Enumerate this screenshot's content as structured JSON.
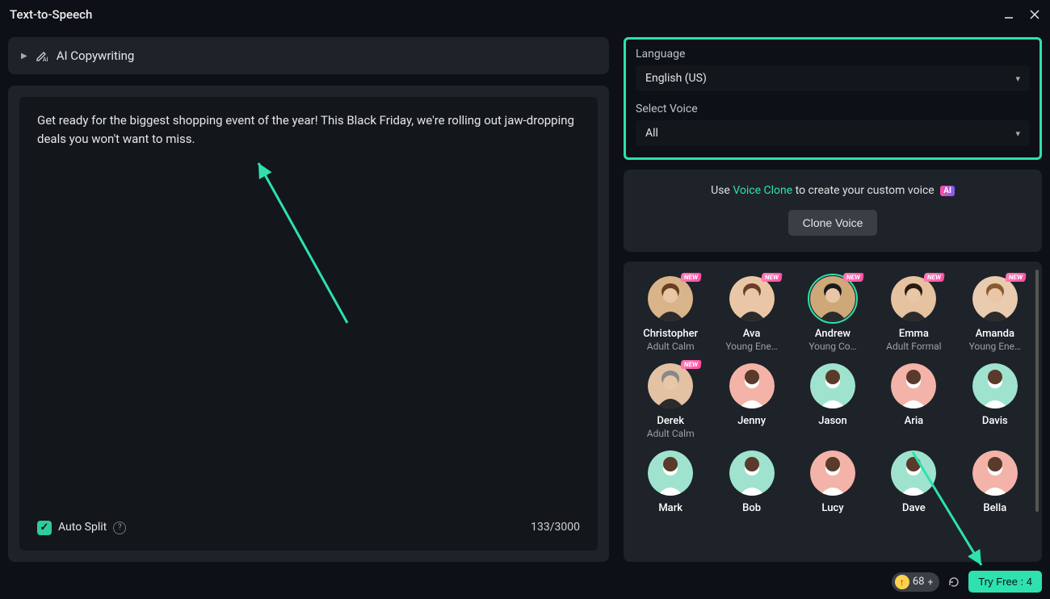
{
  "window": {
    "title": "Text-to-Speech"
  },
  "ai_copywriting": {
    "label": "AI Copywriting"
  },
  "editor": {
    "text": "Get ready for the biggest shopping event of the year! This Black Friday, we're rolling out jaw-dropping deals you won't want to miss.",
    "auto_split_label": "Auto Split",
    "char_count": "133/3000"
  },
  "language": {
    "label": "Language",
    "value": "English (US)"
  },
  "voice_filter": {
    "label": "Select Voice",
    "value": "All"
  },
  "clone": {
    "prefix": "Use ",
    "link": "Voice Clone",
    "suffix": " to create your custom voice",
    "badge": "AI",
    "button": "Clone Voice"
  },
  "voices": [
    {
      "name": "Christopher",
      "sub": "Adult Calm",
      "new": true,
      "photo": true,
      "selected": false,
      "bg": "#d9b48a",
      "hair": "#6b3d1f"
    },
    {
      "name": "Ava",
      "sub": "Young Ene…",
      "new": true,
      "photo": true,
      "selected": false,
      "bg": "#e9c7a6",
      "hair": "#6b3d2a"
    },
    {
      "name": "Andrew",
      "sub": "Young Co…",
      "new": true,
      "photo": true,
      "selected": true,
      "bg": "#cfa87a",
      "hair": "#1a1a1a"
    },
    {
      "name": "Emma",
      "sub": "Adult Formal",
      "new": true,
      "photo": true,
      "selected": false,
      "bg": "#e5c2a0",
      "hair": "#2a1a10"
    },
    {
      "name": "Amanda",
      "sub": "Young Ene…",
      "new": true,
      "photo": true,
      "selected": false,
      "bg": "#e9cbb0",
      "hair": "#8a5a2e"
    },
    {
      "name": "Derek",
      "sub": "Adult Calm",
      "new": true,
      "photo": true,
      "selected": false,
      "bg": "#e2c2a3",
      "hair": "#888888"
    },
    {
      "name": "Jenny",
      "sub": "",
      "new": false,
      "photo": false,
      "selected": false,
      "color": "#f4b3a8"
    },
    {
      "name": "Jason",
      "sub": "",
      "new": false,
      "photo": false,
      "selected": false,
      "color": "#9fe3cf"
    },
    {
      "name": "Aria",
      "sub": "",
      "new": false,
      "photo": false,
      "selected": false,
      "color": "#f4b3a8"
    },
    {
      "name": "Davis",
      "sub": "",
      "new": false,
      "photo": false,
      "selected": false,
      "color": "#9fe3cf"
    },
    {
      "name": "Mark",
      "sub": "",
      "new": false,
      "photo": false,
      "selected": false,
      "color": "#9fe3cf"
    },
    {
      "name": "Bob",
      "sub": "",
      "new": false,
      "photo": false,
      "selected": false,
      "color": "#9fe3cf"
    },
    {
      "name": "Lucy",
      "sub": "",
      "new": false,
      "photo": false,
      "selected": false,
      "color": "#f4b3a8"
    },
    {
      "name": "Dave",
      "sub": "",
      "new": false,
      "photo": false,
      "selected": false,
      "color": "#9fe3cf"
    },
    {
      "name": "Bella",
      "sub": "",
      "new": false,
      "photo": false,
      "selected": false,
      "color": "#f4b3a8"
    }
  ],
  "footer": {
    "credits": "68",
    "try_free": "Try Free : 4"
  }
}
